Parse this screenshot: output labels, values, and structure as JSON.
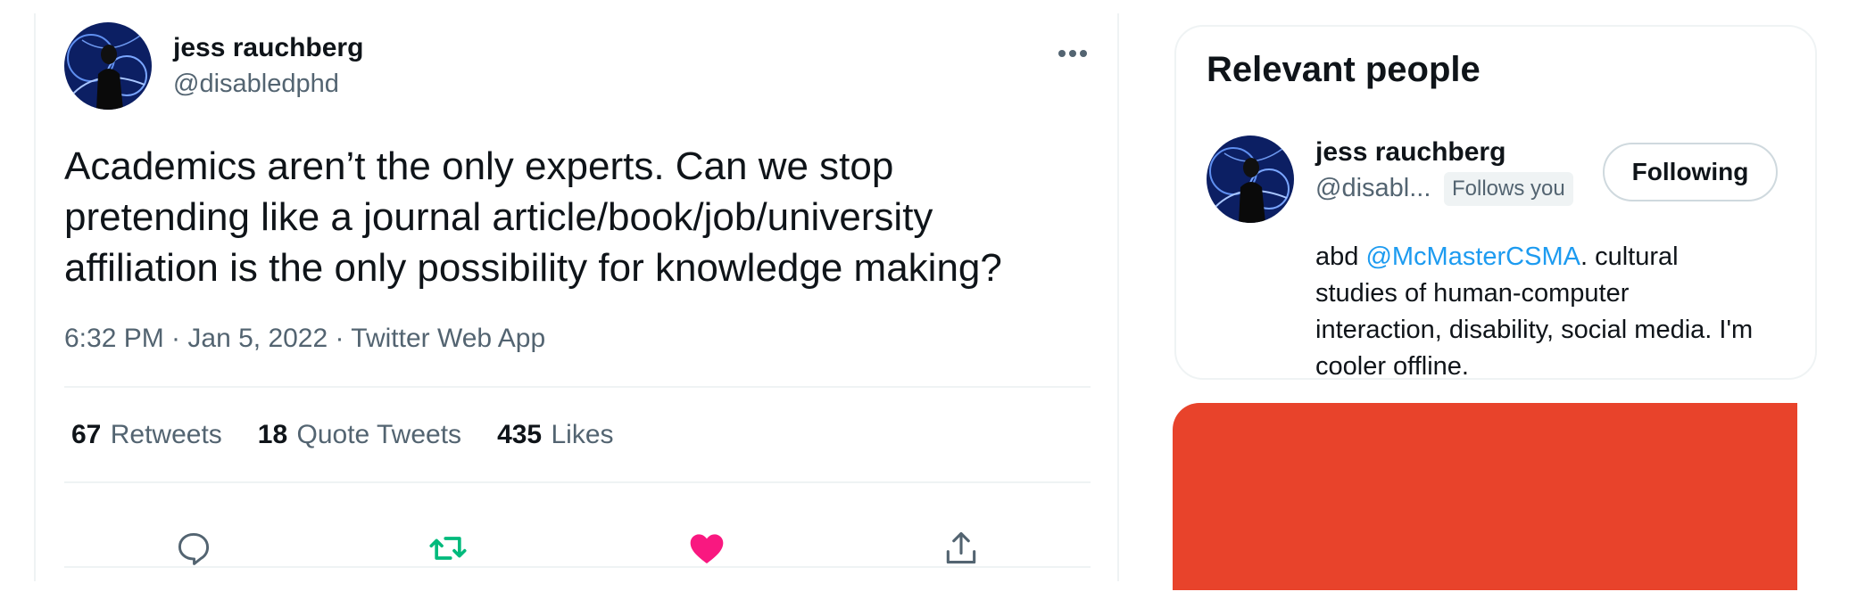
{
  "tweet": {
    "author": {
      "name": "jess rauchberg",
      "handle": "@disabledphd"
    },
    "text": "Academics aren’t the only experts. Can we stop\npretending like a journal article/book/job/university\naffiliation is the only possibility for knowledge making?",
    "meta": "6:32 PM · Jan 5, 2022 · Twitter Web App",
    "stats": [
      {
        "count": "67",
        "label": "Retweets"
      },
      {
        "count": "18",
        "label": "Quote Tweets"
      },
      {
        "count": "435",
        "label": "Likes"
      }
    ],
    "actions": [
      "reply-icon",
      "retweet-icon",
      "like-icon",
      "share-icon"
    ],
    "colors": {
      "retweet": "#00ba7c",
      "like": "#f91880",
      "muted": "#536471"
    }
  },
  "sidebar": {
    "title": "Relevant people",
    "person": {
      "name": "jess rauchberg",
      "handle": "@disabl...",
      "badge": "Follows you",
      "button": "Following",
      "bio_prefix": "abd ",
      "bio_mention": "@McMasterCSMA",
      "bio_suffix": ". cultural studies of human-computer interaction, disability, social media. I'm cooler offline."
    },
    "colors": {
      "link": "#1d9bf0",
      "promo_block": "#e8432b"
    }
  }
}
